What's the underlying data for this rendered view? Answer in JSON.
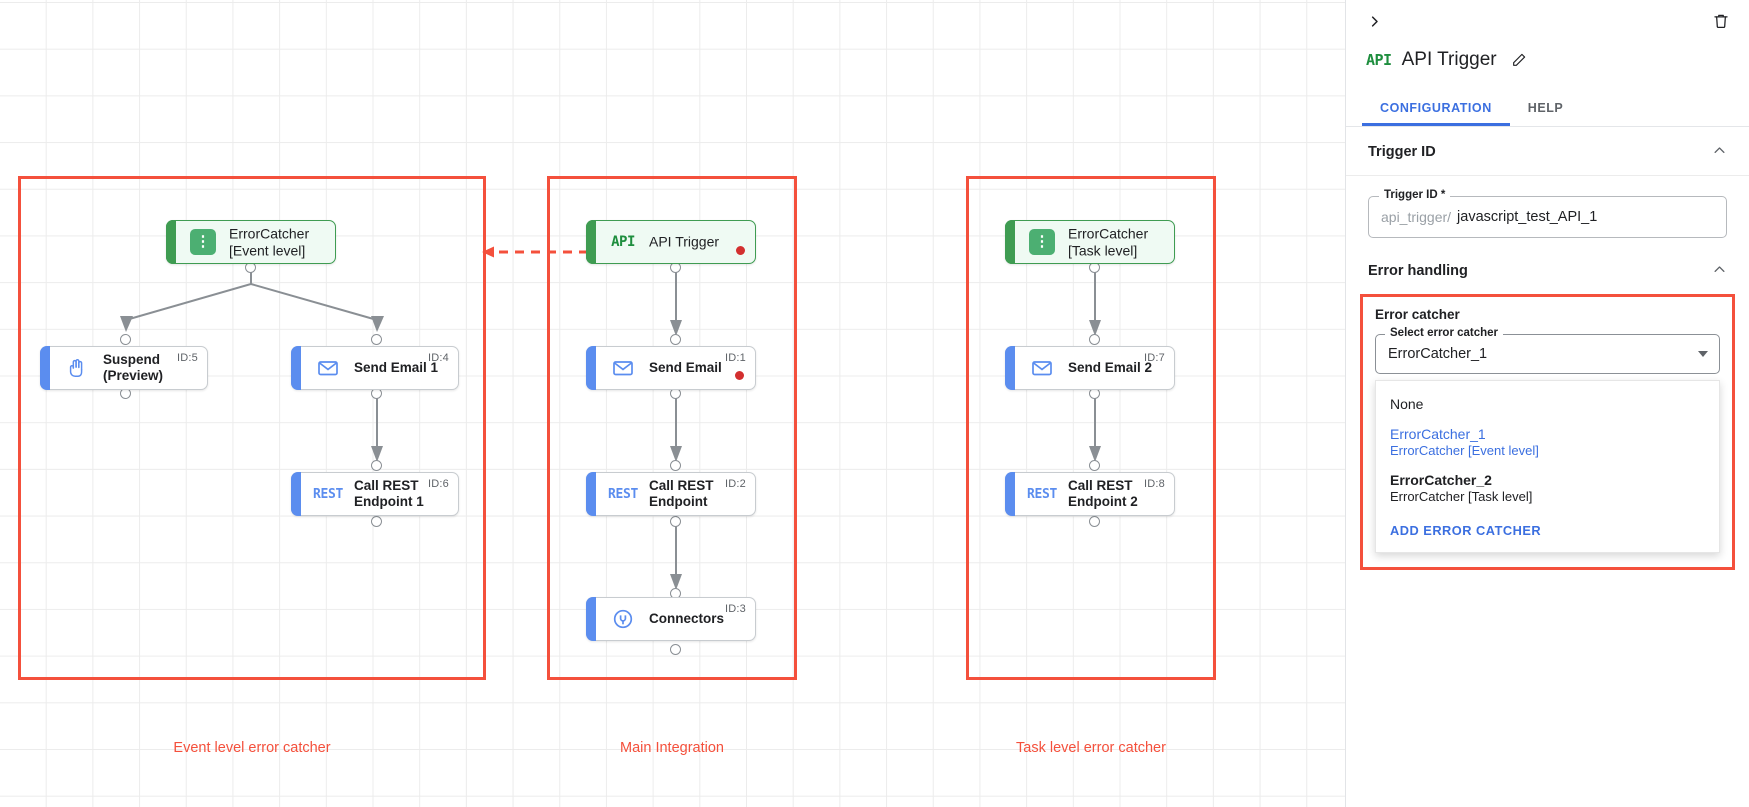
{
  "canvas": {
    "groups": [
      {
        "id": "event-level",
        "label": "Event level error catcher"
      },
      {
        "id": "main-integration",
        "label": "Main Integration"
      },
      {
        "id": "task-level",
        "label": "Task level error catcher"
      }
    ],
    "nodes": [
      {
        "key": "errorcatcher_event",
        "title": "ErrorCatcher\n[Event level]",
        "icon": "errorcatcher-icon",
        "kind": "green",
        "id_label": "",
        "has_error_dot": false
      },
      {
        "key": "suspend",
        "title": "Suspend\n(Preview)",
        "icon": "hand-icon",
        "kind": "blue",
        "id_label": "ID:5",
        "has_error_dot": false
      },
      {
        "key": "send_email_1",
        "title": "Send Email 1",
        "icon": "envelope-icon",
        "kind": "blue",
        "id_label": "ID:4",
        "has_error_dot": false
      },
      {
        "key": "call_rest_1",
        "title": "Call REST\nEndpoint 1",
        "icon": "rest-icon",
        "kind": "blue",
        "id_label": "ID:6",
        "has_error_dot": false
      },
      {
        "key": "api_trigger",
        "title": "API Trigger",
        "icon": "api-icon",
        "kind": "green",
        "id_label": "",
        "has_error_dot": true
      },
      {
        "key": "send_email",
        "title": "Send Email",
        "icon": "envelope-icon",
        "kind": "blue",
        "id_label": "ID:1",
        "has_error_dot": true
      },
      {
        "key": "call_rest",
        "title": "Call REST\nEndpoint",
        "icon": "rest-icon",
        "kind": "blue",
        "id_label": "ID:2",
        "has_error_dot": false
      },
      {
        "key": "connectors",
        "title": "Connectors",
        "icon": "connector-icon",
        "kind": "blue",
        "id_label": "ID:3",
        "has_error_dot": false
      },
      {
        "key": "errorcatcher_task",
        "title": "ErrorCatcher\n[Task level]",
        "icon": "errorcatcher-icon",
        "kind": "green",
        "id_label": "",
        "has_error_dot": false
      },
      {
        "key": "send_email_2",
        "title": "Send Email 2",
        "icon": "envelope-icon",
        "kind": "blue",
        "id_label": "ID:7",
        "has_error_dot": false
      },
      {
        "key": "call_rest_2",
        "title": "Call REST\nEndpoint 2",
        "icon": "rest-icon",
        "kind": "blue",
        "id_label": "ID:8",
        "has_error_dot": false
      }
    ],
    "colors": {
      "group_frame": "#f4503c",
      "group_label": "#f4503c",
      "node_accent_blue": "#5b8def",
      "node_accent_green": "#3f9c52",
      "error_dot": "#d32f2f"
    }
  },
  "panel": {
    "title": "API Trigger",
    "title_icon": "API",
    "collapse_icon": "chevron-right-icon",
    "delete_icon": "trash-icon",
    "edit_icon": "pencil-icon",
    "tabs": [
      {
        "label": "CONFIGURATION",
        "active": true
      },
      {
        "label": "HELP",
        "active": false
      }
    ],
    "sections": [
      {
        "key": "trigger_id",
        "title": "Trigger ID",
        "expanded": true
      },
      {
        "key": "error_handling",
        "title": "Error handling",
        "expanded": true
      }
    ],
    "trigger_id_field": {
      "label": "Trigger ID *",
      "prefix": "api_trigger/",
      "value": "javascript_test_API_1"
    },
    "error_catcher": {
      "box_title": "Error catcher",
      "select_label": "Select error catcher",
      "selected_value": "ErrorCatcher_1",
      "options": [
        {
          "main": "None",
          "sub": "",
          "selected": false,
          "bold": false
        },
        {
          "main": "ErrorCatcher_1",
          "sub": "ErrorCatcher [Event level]",
          "selected": true,
          "bold": false
        },
        {
          "main": "ErrorCatcher_2",
          "sub": "ErrorCatcher [Task level]",
          "selected": false,
          "bold": true
        }
      ],
      "action_label": "ADD ERROR CATCHER",
      "accent_color": "#3b6fe0",
      "highlight_color": "#f4503c"
    }
  }
}
